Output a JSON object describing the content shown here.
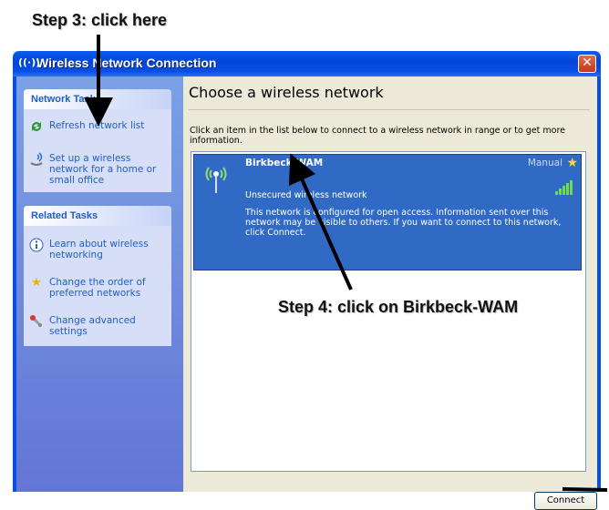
{
  "annotations": {
    "step3": "Step 3: click here",
    "step4": "Step 4: click on Birkbeck-WAM"
  },
  "window": {
    "title": "Wireless Network Connection",
    "close_glyph": "✕"
  },
  "sidebar": {
    "network_tasks": {
      "header": "Network Tasks",
      "items": [
        {
          "label": "Refresh network list",
          "icon": "refresh-icon"
        },
        {
          "label": "Set up a wireless network for a home or small office",
          "icon": "wireless-setup-icon"
        }
      ]
    },
    "related_tasks": {
      "header": "Related Tasks",
      "items": [
        {
          "label": "Learn about wireless networking",
          "icon": "info-icon"
        },
        {
          "label": "Change the order of preferred networks",
          "icon": "star-icon"
        },
        {
          "label": "Change advanced settings",
          "icon": "settings-icon"
        }
      ]
    }
  },
  "main": {
    "heading": "Choose a wireless network",
    "intro": "Click an item in the list below to connect to a wireless network in range or to get more information.",
    "networks": [
      {
        "name": "Birkbeck-WAM",
        "connection": "Manual",
        "status": "Unsecured wireless network",
        "description": "This network is configured for open access. Information sent over this network may be visible to others. If you want to connect to this network, click Connect.",
        "signal": "5 bars",
        "selected": true
      }
    ],
    "connect_label": "Connect"
  },
  "colors": {
    "titlebar": "#0a5ef0",
    "selection": "#316ac5",
    "sidebar": "#7aa1e6",
    "task_link": "#215dc6"
  }
}
